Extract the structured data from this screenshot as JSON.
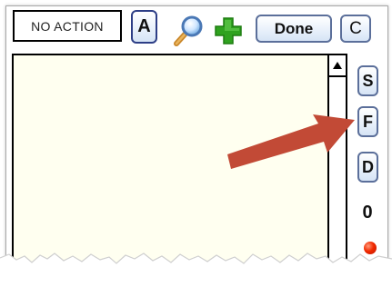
{
  "toolbar": {
    "action_field_value": "NO ACTION",
    "a_label": "A",
    "magnifier_icon": "magnifier-icon",
    "add_icon": "plus-icon",
    "done_label": "Done",
    "c_label": "C"
  },
  "side_buttons": {
    "s_label": "S",
    "f_label": "F",
    "d_label": "D"
  },
  "status": {
    "count": "0",
    "indicator_color": "#f12a00"
  },
  "annotation": {
    "arrow_color": "#c24a36",
    "arrow_target": "F"
  },
  "colors": {
    "list_background": "#fffff0",
    "button_border": "#5b6f9a",
    "plus_green": "#2fa21f"
  }
}
